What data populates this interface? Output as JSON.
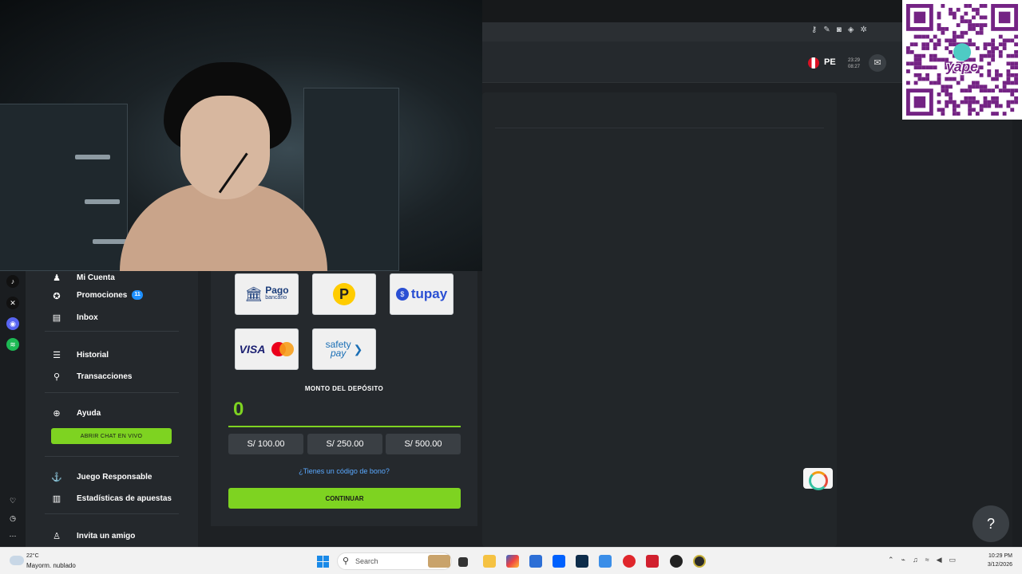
{
  "header": {
    "country_code": "PE",
    "mini_clock_time": "23:29",
    "mini_clock_sub": "08:27",
    "mail_icon": "mail-icon"
  },
  "sidebar": {
    "items": [
      {
        "label": "Mi Cuenta",
        "icon": "user-icon"
      },
      {
        "label": "Promociones",
        "icon": "star-icon",
        "badge": "11"
      },
      {
        "label": "Inbox",
        "icon": "inbox-icon"
      },
      {
        "label": "Historial",
        "icon": "history-icon"
      },
      {
        "label": "Transacciones",
        "icon": "transactions-icon"
      },
      {
        "label": "Ayuda",
        "icon": "lifebuoy-icon"
      },
      {
        "label": "Juego Responsable",
        "icon": "anchor-icon"
      },
      {
        "label": "Estadísticas de apuestas",
        "icon": "stats-icon"
      },
      {
        "label": "Invita un amigo",
        "icon": "invite-icon"
      }
    ],
    "live_chat_label": "ABRIR CHAT EN VIVO"
  },
  "rail": {
    "icons": [
      "tiktok-icon",
      "x-icon",
      "discord-icon",
      "spotify-icon",
      "heart-icon",
      "clock-icon",
      "more-icon"
    ]
  },
  "deposit": {
    "methods": [
      {
        "name": "Pago bancario",
        "line1": "Pago",
        "line2": "bancario"
      },
      {
        "name": "PagoEfectivo",
        "line1": "P"
      },
      {
        "name": "tupay",
        "line1": "tupay"
      },
      {
        "name": "VISA Mastercard",
        "line1": "VISA"
      },
      {
        "name": "SafetyPay",
        "line1": "safety",
        "line2": "pay"
      }
    ],
    "amount_title": "MONTO DEL DEPÓSITO",
    "amount_value": "0",
    "presets": [
      "S/ 100.00",
      "S/ 250.00",
      "S/ 500.00"
    ],
    "bonus_link": "¿Tienes un código de bono?",
    "continue_label": "CONTINUAR"
  },
  "qr": {
    "label": "yape",
    "brand_color": "#742384"
  },
  "colors": {
    "accent": "#7ed321",
    "link": "#5aa9ff",
    "badge": "#1e90ff"
  },
  "taskbar": {
    "weather_temp": "22°C",
    "weather_desc": "Mayorm. nublado",
    "search_placeholder": "Search",
    "time": "10:29 PM",
    "date": "3/12/2026"
  }
}
